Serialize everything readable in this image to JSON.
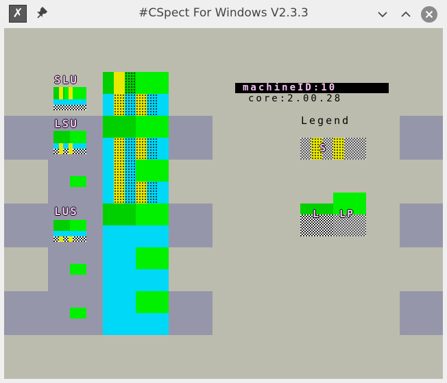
{
  "window": {
    "title": "#CSpect For Windows V2.3.3",
    "app_icon": "cspect-x-icon",
    "buttons": [
      "minimize-icon",
      "maximize-icon",
      "close-icon"
    ]
  },
  "screen": {
    "labels": {
      "slu": "SLU",
      "lsu": "LSU",
      "lus": "LUS"
    },
    "machine_id": "machineID:10",
    "core": "core:2.00.28",
    "legend_title": "Legend",
    "legend_s": "S",
    "legend_l": "L",
    "legend_lp": "LP"
  },
  "colors": {
    "background": "#bcbcae",
    "lavender": "#9696aa",
    "green": "#00f000",
    "dark_green": "#00d000",
    "cyan": "#00d8f8",
    "yellow": "#e8e800",
    "label_pink": "#f7c3f7"
  }
}
